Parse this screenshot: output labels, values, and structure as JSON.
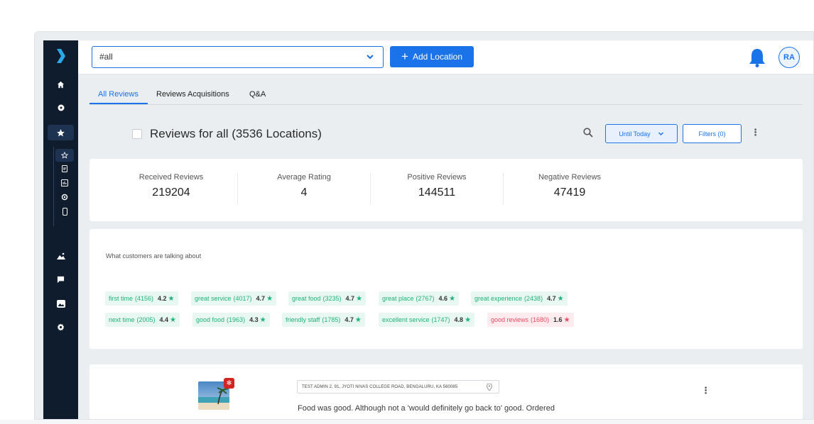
{
  "topbar": {
    "location_value": "#all",
    "add_location_label": "Add Location",
    "avatar_initials": "RA"
  },
  "tabs": [
    {
      "label": "All Reviews",
      "active": true
    },
    {
      "label": "Reviews Acquisitions",
      "active": false
    },
    {
      "label": "Q&A",
      "active": false
    }
  ],
  "reviews_header": {
    "title": "Reviews for all (3536 Locations)",
    "date_filter": "Until Today",
    "filters_label": "Filters (0)"
  },
  "stats": [
    {
      "label": "Received Reviews",
      "value": "219204"
    },
    {
      "label": "Average Rating",
      "value": "4"
    },
    {
      "label": "Positive Reviews",
      "value": "144511"
    },
    {
      "label": "Negative Reviews",
      "value": "47419"
    }
  ],
  "topics": {
    "header": "What customers are talking about",
    "chips": [
      {
        "term": "first time",
        "count": "(4156)",
        "rating": "4.2",
        "sentiment": "positive"
      },
      {
        "term": "great service",
        "count": "(4017)",
        "rating": "4.7",
        "sentiment": "positive"
      },
      {
        "term": "great food",
        "count": "(3235)",
        "rating": "4.7",
        "sentiment": "positive"
      },
      {
        "term": "great place",
        "count": "(2767)",
        "rating": "4.6",
        "sentiment": "positive"
      },
      {
        "term": "great experience",
        "count": "(2438)",
        "rating": "4.7",
        "sentiment": "positive"
      },
      {
        "term": "next time",
        "count": "(2005)",
        "rating": "4.4",
        "sentiment": "positive"
      },
      {
        "term": "good food",
        "count": "(1963)",
        "rating": "4.3",
        "sentiment": "positive"
      },
      {
        "term": "friendly staff",
        "count": "(1785)",
        "rating": "4.7",
        "sentiment": "positive"
      },
      {
        "term": "excellent service",
        "count": "(1747)",
        "rating": "4.8",
        "sentiment": "positive"
      },
      {
        "term": "good reviews",
        "count": "(1680)",
        "rating": "1.6",
        "sentiment": "negative"
      }
    ]
  },
  "review": {
    "source_badge": "yelp",
    "address": "TEST ADMIN 2, 91, JYOTI NIVAS COLLEGE ROAD, BENGALURU, KA 560085",
    "text": "Food was good. Although not a 'would definitely go back to' good. Ordered"
  },
  "sidebar": {
    "icons": [
      "chevron-logo",
      "home-icon",
      "location-icon",
      "star-icon",
      "star-outline-icon",
      "document-icon",
      "chart-icon",
      "settings-icon",
      "mobile-icon",
      "image-icon",
      "message-icon",
      "gallery-icon",
      "gear-icon"
    ]
  },
  "colors": {
    "primary": "#1a73e8",
    "sidebar": "#0f1c2e",
    "positive": "#20b27a",
    "negative": "#e44b5e",
    "background": "#ebeef1"
  }
}
